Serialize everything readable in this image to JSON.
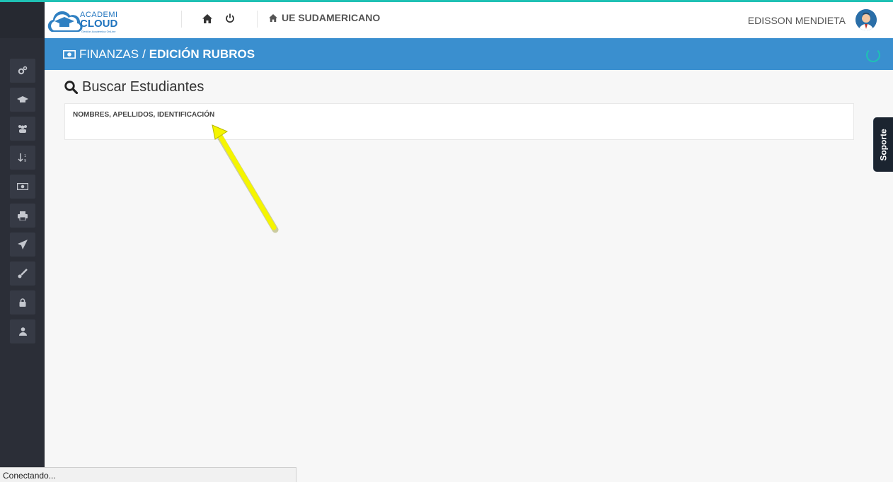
{
  "header": {
    "logo_line1": "ACADEMI",
    "logo_line2": "CLOUD",
    "logo_sub": "Gestión Académica OnLine",
    "school": "UE SUDAMERICANO",
    "user_name": "EDISSON MENDIETA"
  },
  "breadcrumb": {
    "section": "FINANZAS",
    "separator": "/",
    "page": "EDICIÓN RUBROS"
  },
  "search": {
    "title": "Buscar Estudiantes",
    "label": "NOMBRES, APELLIDOS, IDENTIFICACIÓN",
    "value": ""
  },
  "sidebar": {
    "items": [
      {
        "icon": "gears-icon",
        "glyph": "⚙"
      },
      {
        "icon": "graduation-cap-icon",
        "glyph": "🎓"
      },
      {
        "icon": "users-icon",
        "glyph": "👥"
      },
      {
        "icon": "sort-numeric-icon",
        "glyph": "↓"
      },
      {
        "icon": "money-icon",
        "glyph": "💵"
      },
      {
        "icon": "print-icon",
        "glyph": "🖶"
      },
      {
        "icon": "paper-plane-icon",
        "glyph": "➤"
      },
      {
        "icon": "paint-brush-icon",
        "glyph": "🖌"
      },
      {
        "icon": "lock-icon",
        "glyph": "🔒"
      },
      {
        "icon": "user-icon",
        "glyph": "👤"
      }
    ]
  },
  "soporte_label": "Soporte",
  "status_text": "Conectando...",
  "colors": {
    "accent_top": "#1fc1b4",
    "bluebar": "#3a8fcf",
    "sidebar": "#2b2e37",
    "annotation_arrow": "#f5f500"
  }
}
